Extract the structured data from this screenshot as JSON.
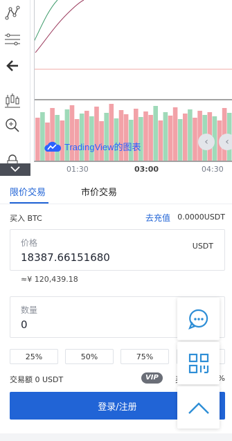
{
  "chart": {
    "watermark": "TradingView的图表",
    "times": [
      "01:30",
      "03:00",
      "04:30"
    ],
    "colors": {
      "up": "#9fdab9",
      "down": "#f2a2a8",
      "accent": "#2962ff"
    }
  },
  "toolbar": {
    "icons": [
      "pattern-icon",
      "fib-icon",
      "back-arrow-icon",
      "candles-icon",
      "zoom-in-icon",
      "lock-icon",
      "collapse-icon"
    ]
  },
  "tabs": [
    {
      "label": "限价交易",
      "active": true
    },
    {
      "label": "市价交易",
      "active": false
    }
  ],
  "trade": {
    "buy_label": "买入 BTC",
    "recharge_label": "去充值",
    "available": "0.0000USDT",
    "price": {
      "label": "价格",
      "value": "18387.66151680",
      "unit": "USDT"
    },
    "approx": "≈¥ 120,439.18",
    "quantity": {
      "label": "数量",
      "value": "0"
    },
    "percents": [
      "25%",
      "50%",
      "75%"
    ],
    "amount_label": "交易额 0 USDT",
    "vip": "VIP",
    "vip_buy": "买入",
    "vip_pct_tail": "%",
    "login_label": "登录/注册"
  },
  "floating": [
    "chat-icon",
    "qrcode-icon",
    "scroll-top-icon"
  ]
}
